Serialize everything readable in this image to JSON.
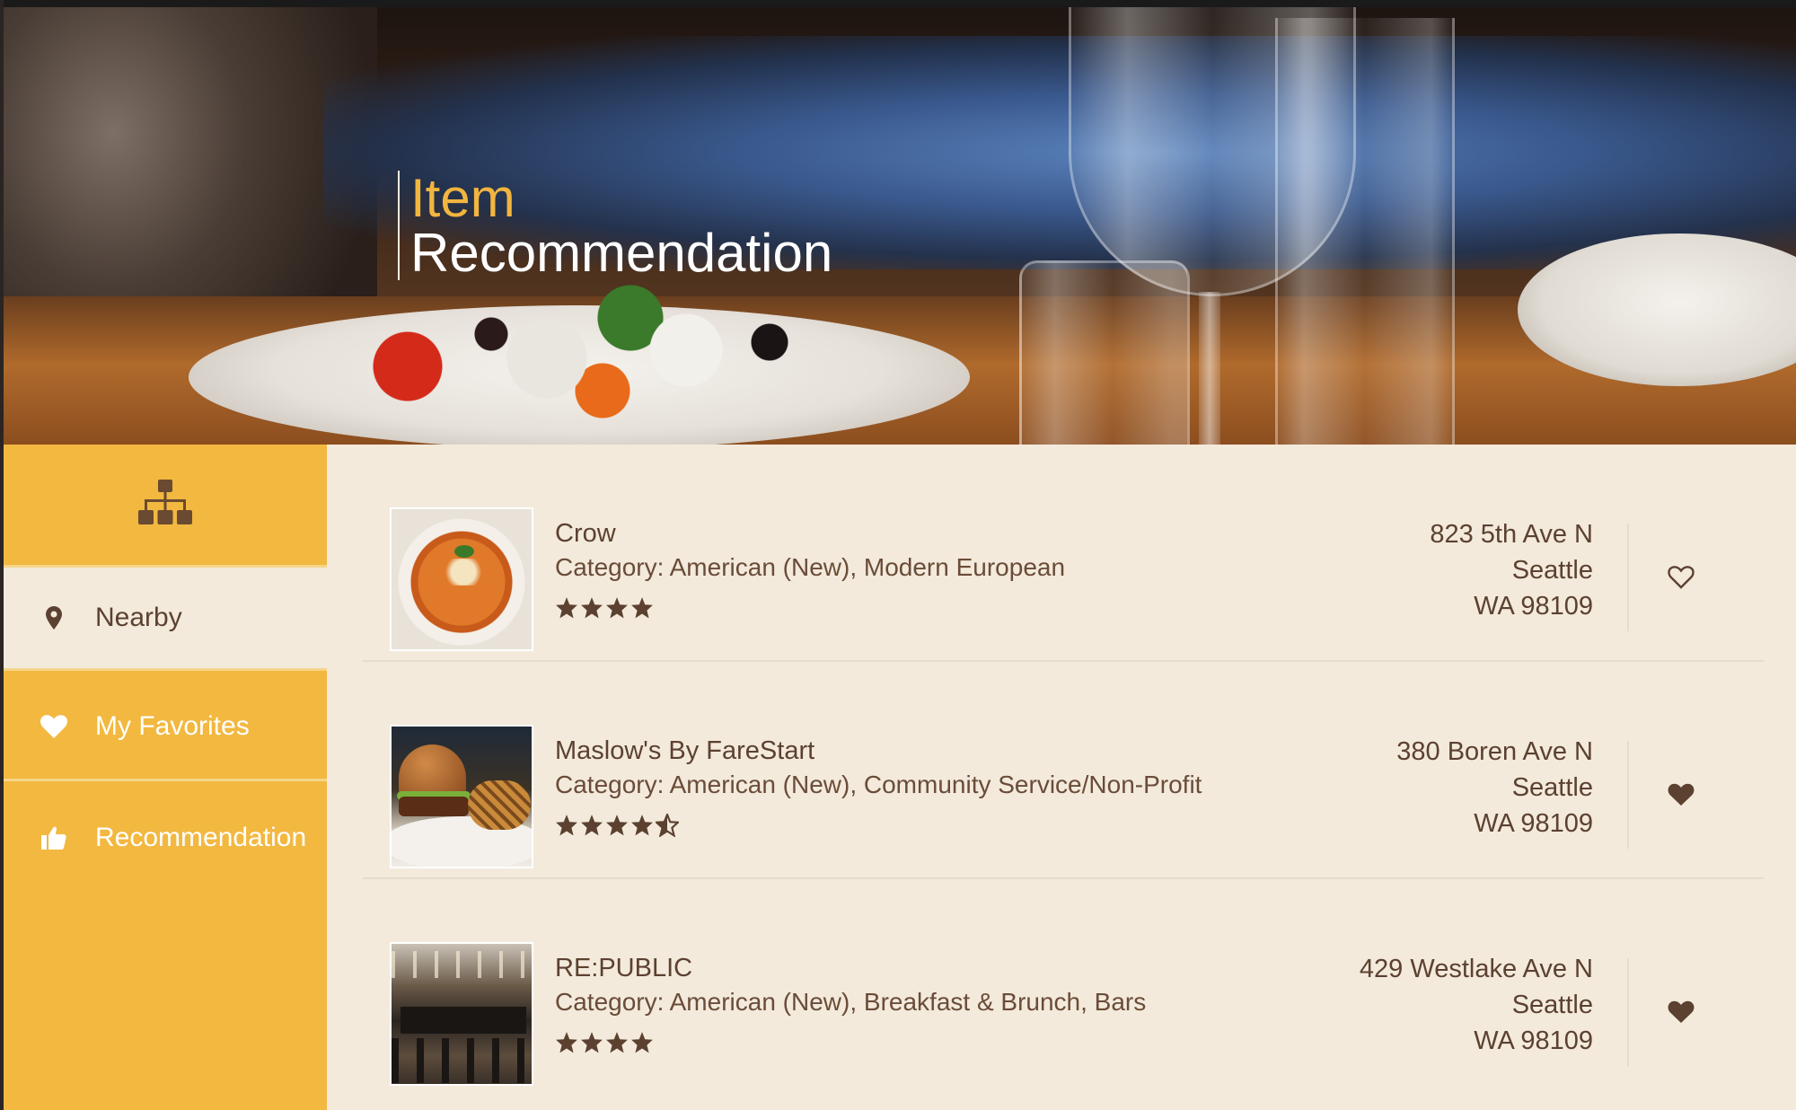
{
  "header": {
    "title_line1": "Item",
    "title_line2": "Recommendation"
  },
  "colors": {
    "accent": "#f2b840",
    "brown": "#5c4130",
    "background": "#f3eadc"
  },
  "sidebar": {
    "top_icon": "sitemap-icon",
    "items": [
      {
        "label": "Nearby",
        "icon": "map-pin-icon",
        "active": true
      },
      {
        "label": "My Favorites",
        "icon": "heart-icon",
        "active": false
      },
      {
        "label": "Recommendation",
        "icon": "thumbs-up-icon",
        "active": false
      }
    ]
  },
  "items": [
    {
      "name": "Crow",
      "category": "Category: American (New), Modern European",
      "rating": 4,
      "address": [
        "823 5th Ave N",
        "Seattle",
        "WA 98109"
      ],
      "favorite": false,
      "thumb_icon": "pasta-photo"
    },
    {
      "name": "Maslow's By FareStart",
      "category": "Category: American (New), Community Service/Non-Profit",
      "rating": 4.5,
      "address": [
        "380 Boren Ave N",
        "Seattle",
        "WA 98109"
      ],
      "favorite": true,
      "thumb_icon": "burger-photo"
    },
    {
      "name": "RE:PUBLIC",
      "category": "Category: American (New), Breakfast & Brunch, Bars",
      "rating": 4,
      "address": [
        "429 Westlake Ave N",
        "Seattle",
        "WA 98109"
      ],
      "favorite": true,
      "thumb_icon": "restaurant-interior-photo"
    }
  ]
}
